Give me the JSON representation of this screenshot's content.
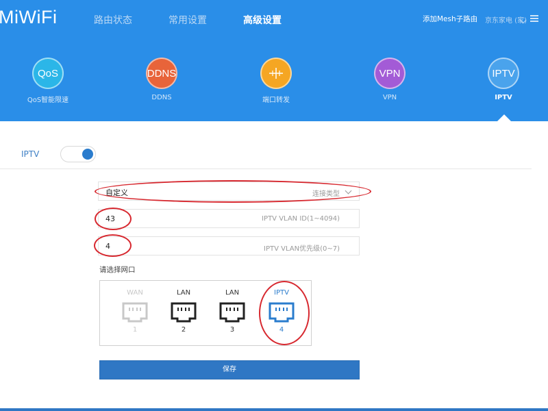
{
  "logo": "MiWiFi",
  "nav": [
    {
      "label": "路由状态",
      "active": false
    },
    {
      "label": "常用设置",
      "active": false
    },
    {
      "label": "高级设置",
      "active": true
    }
  ],
  "header_right": {
    "add_mesh": "添加Mesh子路由",
    "router_name": "京东家电 (家)"
  },
  "features": [
    {
      "icon_text": "QoS",
      "label": "QoS智能限速",
      "color": "#2bb6e8",
      "active": false
    },
    {
      "icon_text": "DDNS",
      "label": "DDNS",
      "color": "#e8643a",
      "active": false
    },
    {
      "icon_text": "",
      "label": "端口转发",
      "color": "#f5a623",
      "active": false
    },
    {
      "icon_text": "VPN",
      "label": "VPN",
      "color": "#a35bd6",
      "active": false
    },
    {
      "icon_text": "IPTV",
      "label": "IPTV",
      "color": "#4aa3ec",
      "active": true
    }
  ],
  "iptv": {
    "label": "IPTV",
    "enabled": true
  },
  "form": {
    "connection_type": {
      "value": "自定义",
      "hint": "连接类型"
    },
    "vlan_id": {
      "value": "43",
      "hint": "IPTV VLAN ID(1~4094)"
    },
    "vlan_priority": {
      "value": "4",
      "hint": "IPTV VLAN优先级(0~7)"
    }
  },
  "ports": {
    "title": "请选择网口",
    "items": [
      {
        "name": "WAN",
        "number": "1",
        "state": "disabled"
      },
      {
        "name": "LAN",
        "number": "2",
        "state": "normal"
      },
      {
        "name": "LAN",
        "number": "3",
        "state": "normal"
      },
      {
        "name": "IPTV",
        "number": "4",
        "state": "selected"
      }
    ]
  },
  "save_label": "保存",
  "colors": {
    "header_bg": "#2a8ee8",
    "accent": "#2f77c4",
    "annotation_red": "#d7282f"
  }
}
